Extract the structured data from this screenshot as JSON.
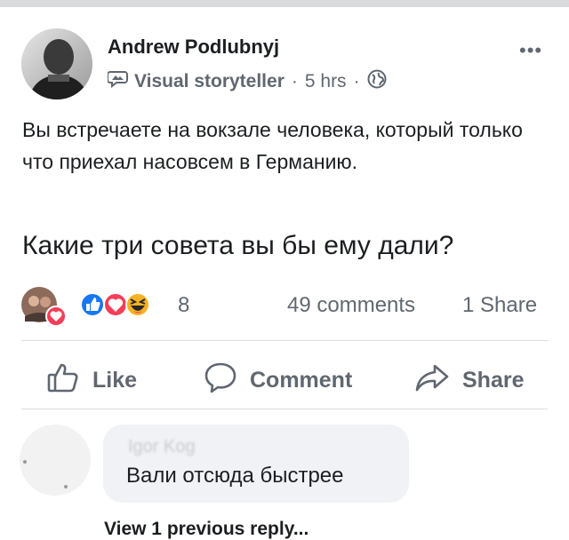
{
  "post": {
    "author": "Andrew Podlubnyj",
    "badge": "Visual storyteller",
    "time": "5 hrs",
    "separator": "·",
    "more_label": "•••",
    "body_line1": "Вы встречаете на вокзале человека, который только что приехал насовсем в Германию.",
    "body_line2": "Какие три совета вы бы ему дали?"
  },
  "stats": {
    "reaction_count": "8",
    "comments": "49 comments",
    "shares": "1 Share"
  },
  "actions": {
    "like": "Like",
    "comment": "Comment",
    "share": "Share"
  },
  "comment": {
    "author": "Igor Kog",
    "text": "Вали отсюда быстрее",
    "view_replies": "View 1 previous reply..."
  },
  "colors": {
    "like_blue": "#1877f2",
    "love_red": "#f33e58",
    "haha_yellow": "#f7b125",
    "meta_grey": "#606770"
  },
  "icons": [
    "visual-storyteller-badge-icon",
    "globe-icon",
    "like-reaction-icon",
    "love-reaction-icon",
    "haha-reaction-icon",
    "thumbs-up-icon",
    "speech-bubble-icon",
    "share-arrow-icon",
    "more-options-icon"
  ]
}
